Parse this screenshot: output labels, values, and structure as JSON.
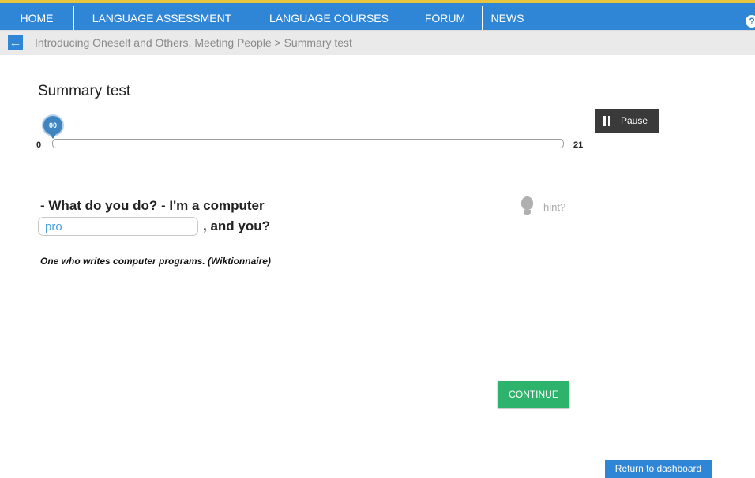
{
  "colors": {
    "nav_background": "#2f86d6",
    "accent_top_line": "#e8c53a",
    "continue_button": "#2db36b",
    "pause_button": "#3a3a3a",
    "progress_marker": "#3f85c2",
    "input_text": "#4aa0dc"
  },
  "nav": {
    "items": [
      {
        "label": "HOME"
      },
      {
        "label": "LANGUAGE ASSESSMENT"
      },
      {
        "label": "LANGUAGE COURSES"
      },
      {
        "label": "FORUM"
      },
      {
        "label": "NEWS"
      }
    ],
    "help_icon": "question-mark-icon"
  },
  "breadcrumb": {
    "back_icon": "arrow-left-icon",
    "text": "Introducing Oneself and Others, Meeting People >  Summary test"
  },
  "page": {
    "title": "Summary test"
  },
  "progress": {
    "current_label": "00",
    "min": "0",
    "max": "21",
    "fraction": 0
  },
  "timer": {
    "pause_label": "Pause",
    "pause_icon": "pause-icon"
  },
  "exercise": {
    "question_text": "- What do you do? - I'm a computer",
    "answer_value": "pro",
    "answer_suffix": ", and you?",
    "definition": "One who writes computer programs. (Wiktionnaire)",
    "hint_label": "hint?",
    "hint_icon": "lightbulb-icon"
  },
  "actions": {
    "continue_label": "CONTINUE",
    "return_label": "Return to dashboard"
  }
}
